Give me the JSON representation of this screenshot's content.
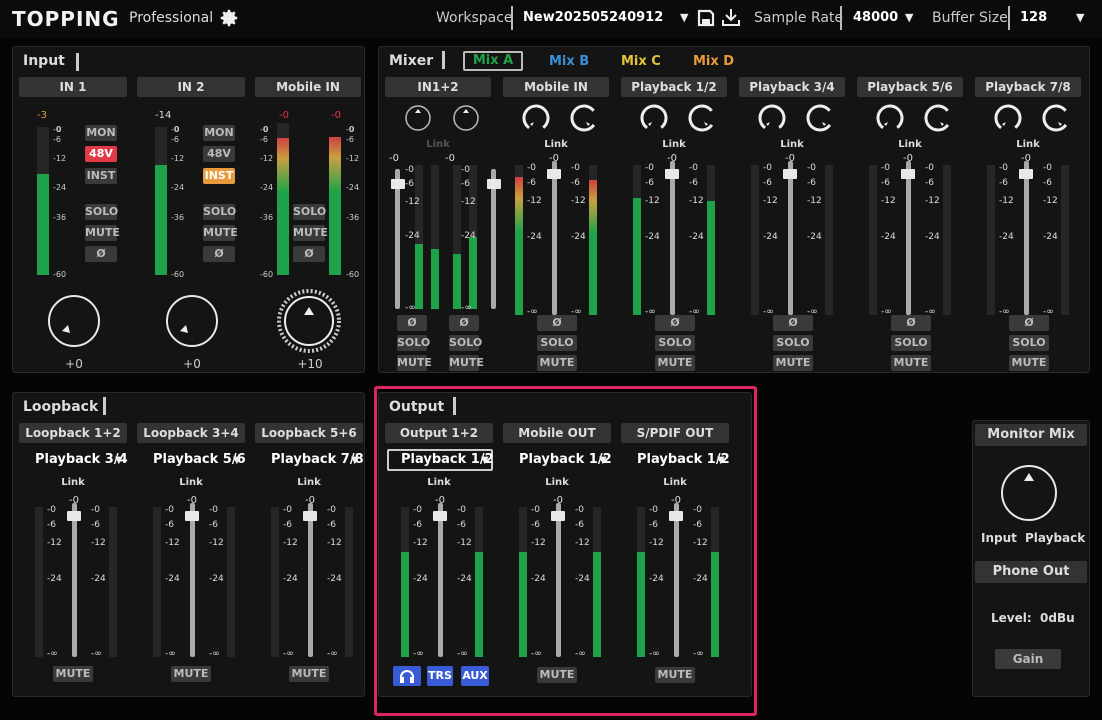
{
  "header": {
    "logo": "TOPPING",
    "logo_sub": "Professional",
    "workspace_label": "Workspace",
    "workspace_value": "New202505240912",
    "sample_rate_label": "Sample Rate",
    "sample_rate_value": "48000",
    "buffer_label": "Buffer Size",
    "buffer_value": "128"
  },
  "input": {
    "title": "Input",
    "channels": [
      {
        "name": "IN 1",
        "peak": "-3",
        "gain": "+0",
        "level": 0.55
      },
      {
        "name": "IN 2",
        "peak": "-14",
        "gain": "+0",
        "level": 0.45
      },
      {
        "name": "Mobile IN",
        "peak_l": "-0",
        "peak_r": "-0",
        "gain": "+10",
        "level": 0.93
      }
    ],
    "buttons": {
      "mon": "MON",
      "p48": "48V",
      "inst": "INST",
      "solo": "SOLO",
      "mute": "MUTE",
      "phase": "Ø"
    },
    "scale": [
      "0",
      "-6",
      "-12",
      "-24",
      "-36",
      "-60"
    ]
  },
  "mixer": {
    "title": "Mixer",
    "tabs": [
      {
        "label": "Mix A",
        "color": "#1ea34a"
      },
      {
        "label": "Mix B",
        "color": "#3a8fd6"
      },
      {
        "label": "Mix C",
        "color": "#e5c43a"
      },
      {
        "label": "Mix D",
        "color": "#e89a3c"
      }
    ],
    "link": "Link",
    "channels": [
      "IN1+2",
      "Mobile IN",
      "Playback 1/2",
      "Playback 3/4",
      "Playback 5/6",
      "Playback 7/8"
    ],
    "solo": "SOLO",
    "mute": "MUTE",
    "phase": "Ø",
    "fader_value": "-0",
    "scale": [
      "-0",
      "-6",
      "-12",
      "-24",
      "-∞"
    ]
  },
  "loopback": {
    "title": "Loopback",
    "channels": [
      {
        "name": "Loopback 1+2",
        "source": "Playback 3/4"
      },
      {
        "name": "Loopback 3+4",
        "source": "Playback 5/6"
      },
      {
        "name": "Loopback 5+6",
        "source": "Playback 7/8"
      }
    ],
    "link": "Link",
    "mute": "MUTE"
  },
  "output": {
    "title": "Output",
    "channels": [
      {
        "name": "Output 1+2",
        "source": "Playback 1/2"
      },
      {
        "name": "Mobile OUT",
        "source": "Playback 1/2"
      },
      {
        "name": "S/PDIF OUT",
        "source": "Playback 1/2"
      }
    ],
    "link": "Link",
    "mute": "MUTE",
    "trs": "TRS",
    "aux": "AUX"
  },
  "monitor": {
    "title": "Monitor Mix",
    "input": "Input",
    "playback": "Playback",
    "phone_out": "Phone Out",
    "level": "Level:  0dBu",
    "gain": "Gain"
  },
  "colors": {
    "accent_green": "#1ea34a",
    "highlight": "#e0245e",
    "red": "#e03a47",
    "orange": "#e89a3c",
    "blue": "#3a5bd6"
  }
}
